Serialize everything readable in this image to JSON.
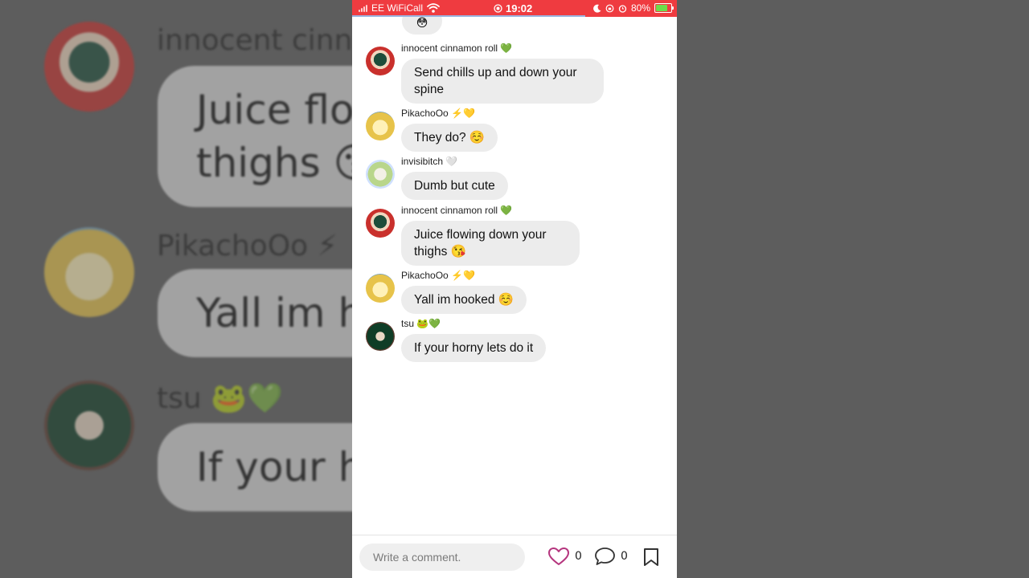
{
  "background": {
    "names": [
      "innocent cinnamon roll",
      "PikachoOo ⚡",
      "tsu 🐸💚"
    ],
    "bubbles": [
      "Juice flo",
      "thighs 😘",
      "Yall im ho",
      "If your ho"
    ]
  },
  "status_bar": {
    "carrier": "EE WiFiCall",
    "time": "19:02",
    "battery": "80%",
    "battery_level": 0.8
  },
  "chat": {
    "top_stub_emoji": "😳",
    "messages": [
      {
        "sender": "innocent cinnamon roll",
        "sender_emoji": "💚",
        "text": "Send chills up and down your spine"
      },
      {
        "sender": "PikachoOo",
        "sender_emoji": "⚡💛",
        "text": "They do? ☺️"
      },
      {
        "sender": "invisibitch",
        "sender_emoji": "🤍",
        "text": "Dumb but cute"
      },
      {
        "sender": "innocent cinnamon roll",
        "sender_emoji": "💚",
        "text": "Juice flowing down your thighs 😘"
      },
      {
        "sender": "PikachoOo",
        "sender_emoji": "⚡💛",
        "text": "Yall im hooked ☺️"
      },
      {
        "sender": "tsu",
        "sender_emoji": "🐸💚",
        "text": "If your horny lets do it"
      }
    ]
  },
  "bottom_bar": {
    "comment_placeholder": "Write a comment.",
    "like_count": "0",
    "comment_count": "0"
  },
  "colors": {
    "status_bar": "#ef3b40",
    "bubble": "#ececec",
    "heart": "#b5357e"
  }
}
